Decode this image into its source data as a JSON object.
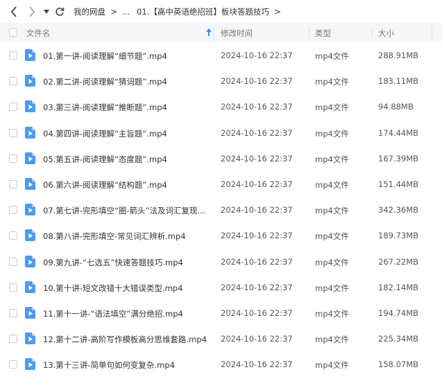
{
  "breadcrumb": {
    "items": [
      "我的网盘",
      "...",
      "01.【高中英语绝招班】板块答题技巧"
    ],
    "separator": ">"
  },
  "table": {
    "columns": {
      "name": "文件名",
      "time": "修改时间",
      "type": "类型",
      "size": "大小"
    },
    "rows": [
      {
        "name": "01.第一讲-阅读理解“细节题”.mp4",
        "time": "2024-10-16 22:37",
        "type": "mp4文件",
        "size": "288.91MB"
      },
      {
        "name": "02.第二讲-阅读理解“猜词题”.mp4",
        "time": "2024-10-16 22:37",
        "type": "mp4文件",
        "size": "183.11MB"
      },
      {
        "name": "03.第三讲-阅读理解“推断题”.mp4",
        "time": "2024-10-16 22:37",
        "type": "mp4文件",
        "size": "94.88MB"
      },
      {
        "name": "04.第四讲-阅读理解“主旨题”.mp4",
        "time": "2024-10-16 22:37",
        "type": "mp4文件",
        "size": "174.44MB"
      },
      {
        "name": "05.第五讲-阅读理解“态度题”.mp4",
        "time": "2024-10-16 22:37",
        "type": "mp4文件",
        "size": "167.39MB"
      },
      {
        "name": "06.第六讲-阅读理解“结构题”.mp4",
        "time": "2024-10-16 22:37",
        "type": "mp4文件",
        "size": "151.44MB"
      },
      {
        "name": "07.第七讲-完形填空“圈-箭头”法及词汇复现...",
        "time": "2024-10-16 22:37",
        "type": "mp4文件",
        "size": "342.36MB"
      },
      {
        "name": "08.第八讲-完形填空-常见词汇辨析.mp4",
        "time": "2024-10-16 22:37",
        "type": "mp4文件",
        "size": "189.73MB"
      },
      {
        "name": "09.第九讲-“七选五”快速答题技巧.mp4",
        "time": "2024-10-16 22:37",
        "type": "mp4文件",
        "size": "267.22MB"
      },
      {
        "name": "10.第十讲-短文改错十大错误类型.mp4",
        "time": "2024-10-16 22:37",
        "type": "mp4文件",
        "size": "182.14MB"
      },
      {
        "name": "11.第十一讲-“语法填空”满分绝招.mp4",
        "time": "2024-10-16 22:37",
        "type": "mp4文件",
        "size": "194.74MB"
      },
      {
        "name": "12.第十二讲-高阶写作模板高分思维套路.mp4",
        "time": "2024-10-16 22:37",
        "type": "mp4文件",
        "size": "225.34MB"
      },
      {
        "name": "13.第十三讲-简单句如何变复杂.mp4",
        "time": "2024-10-16 22:37",
        "type": "mp4文件",
        "size": "158.07MB"
      }
    ]
  },
  "icons": {
    "file": "video-file-icon",
    "back": "chevron-left-icon",
    "forward": "chevron-right-icon",
    "history": "caret-down-icon",
    "refresh": "refresh-icon",
    "sort": "sort-ascending-icon"
  },
  "colors": {
    "file_icon": "#4a9cf0",
    "header_bg": "#f5f6f8",
    "sort_arrow": "#3b8eea"
  }
}
